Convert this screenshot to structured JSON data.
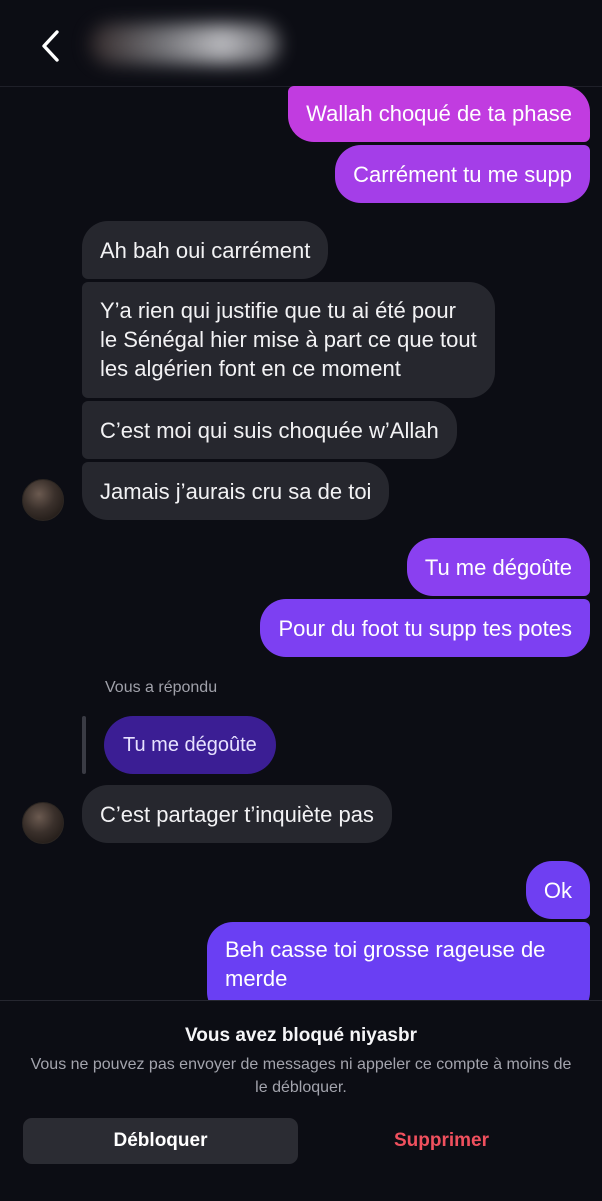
{
  "header": {
    "back_icon": "chevron-left-icon",
    "contact_avatar_icon": "blurred-avatar-icon"
  },
  "messages": [
    {
      "side": "out",
      "text": "Wallah choqué de ta phase"
    },
    {
      "side": "out",
      "text": "Carrément tu me supp"
    },
    {
      "side": "in",
      "text": "Ah bah oui carrément"
    },
    {
      "side": "in",
      "lines": [
        "Y’a rien qui justifie que tu ai été pour",
        "le Sénégal hier mise à part ce que tout",
        "les algérien font en ce moment"
      ]
    },
    {
      "side": "in",
      "text": "C’est moi qui suis choquée w’Allah"
    },
    {
      "side": "in",
      "text": "Jamais j’aurais cru sa de toi"
    },
    {
      "side": "out",
      "text": "Tu me dégoûte"
    },
    {
      "side": "out",
      "text": "Pour du foot tu supp tes potes"
    },
    {
      "side": "in",
      "text": "C’est partager t’inquiète pas"
    },
    {
      "side": "out",
      "text": "Ok"
    },
    {
      "side": "out",
      "lines": [
        "Beh casse toi grosse rageuse de",
        "merde"
      ]
    }
  ],
  "reply": {
    "label": "Vous a répondu",
    "quoted_text": "Tu me dégoûte"
  },
  "footer": {
    "title": "Vous avez bloqué niyasbr",
    "description": "Vous ne pouvez pas envoyer de messages ni appeler ce compte à moins de le débloquer.",
    "unblock_label": "Débloquer",
    "delete_label": "Supprimer"
  },
  "colors": {
    "background": "#0c0d14",
    "incoming_bubble": "#26272e",
    "outgoing_top": "#c13ce0",
    "outgoing_bottom": "#6c3ff2",
    "reply_bubble": "#3b1e94",
    "delete_red": "#f0505e"
  }
}
